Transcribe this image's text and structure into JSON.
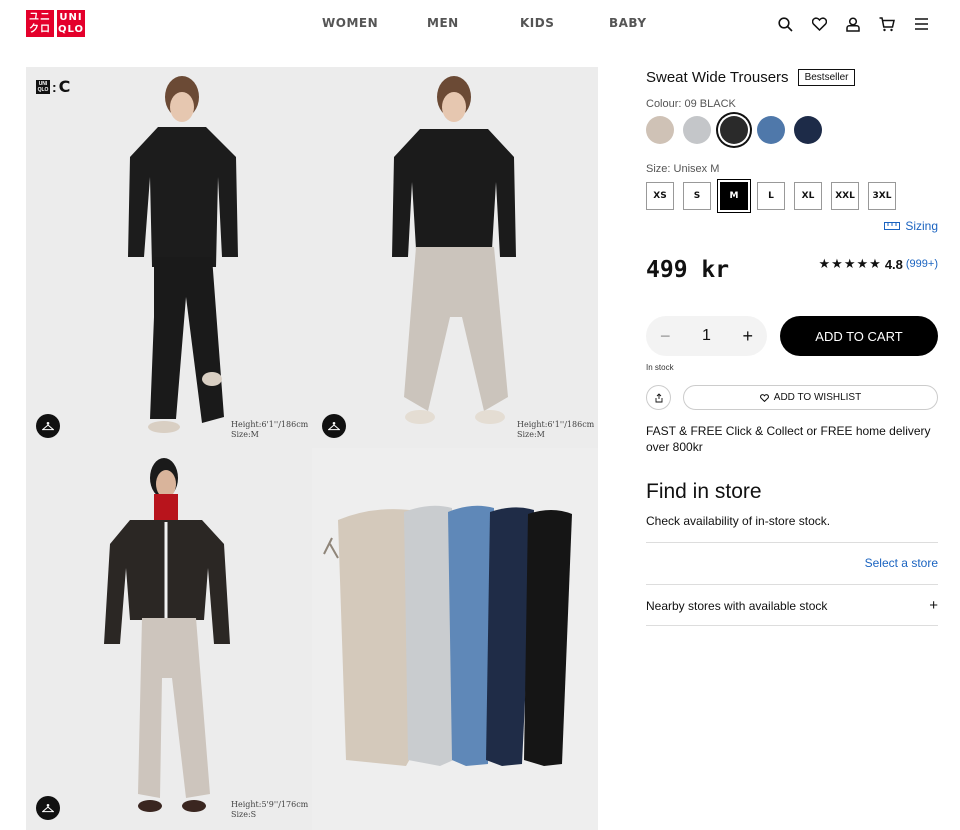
{
  "brand": {
    "logo_left": [
      "ユニ",
      "クロ"
    ],
    "logo_right": [
      "UNI",
      "QLO"
    ],
    "accent_color": "#e4002b"
  },
  "nav": {
    "items": [
      "WOMEN",
      "MEN",
      "KIDS",
      "BABY"
    ]
  },
  "header_icons": [
    "search-icon",
    "heart-icon",
    "user-icon",
    "cart-icon",
    "menu-icon"
  ],
  "gallery": {
    "badge": "UNIQLO : C",
    "badge_box": [
      "UNI",
      "QLO"
    ],
    "badge_c": "C",
    "images": [
      {
        "caption": [
          "Height:6'1''/186cm",
          "Size:M"
        ],
        "has_hanger": true
      },
      {
        "caption": [
          "Height:6'1''/186cm",
          "Size:M"
        ],
        "has_hanger": true
      },
      {
        "caption": [
          "Height:5'9''/176cm",
          "Size:S"
        ],
        "has_hanger": true
      },
      {
        "caption": [],
        "has_hanger": false
      }
    ]
  },
  "product": {
    "title": "Sweat Wide Trousers",
    "badge": "Bestseller",
    "colour_label": "Colour: 09 BLACK",
    "colours": [
      {
        "name": "beige",
        "hex": "#cfc2b6"
      },
      {
        "name": "gray",
        "hex": "#c4c6c9"
      },
      {
        "name": "black",
        "hex": "#2a2a2a",
        "selected": true
      },
      {
        "name": "blue",
        "hex": "#4f78aa"
      },
      {
        "name": "navy",
        "hex": "#1d2b48"
      }
    ],
    "size_label": "Size: Unisex M",
    "sizes": [
      "XS",
      "S",
      "M",
      "L",
      "XL",
      "XXL",
      "3XL"
    ],
    "selected_size": "M",
    "sizing_link": "Sizing",
    "price": "499 kr",
    "rating": {
      "stars": "★★★★★",
      "score": "4.8",
      "count": "(999+)",
      "value": 4.8
    },
    "quantity": {
      "minus": "−",
      "value": "1",
      "plus": "+"
    },
    "add_to_cart": "ADD TO CART",
    "stock_status": "In stock",
    "wishlist": "ADD TO WISHLIST",
    "delivery": "FAST & FREE Click & Collect or FREE home delivery over 800kr"
  },
  "store": {
    "title": "Find in store",
    "subtitle": "Check availability of in-store stock.",
    "select_link": "Select a store",
    "nearby_label": "Nearby stores with available stock",
    "nearby_toggle": "+"
  }
}
